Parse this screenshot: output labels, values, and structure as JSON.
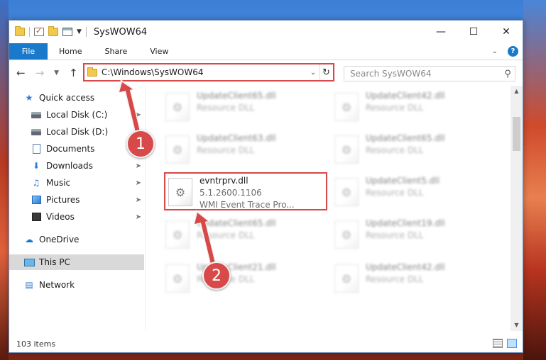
{
  "window": {
    "title": "SysWOW64",
    "controls": {
      "minimize": "—",
      "maximize": "☐",
      "close": "✕"
    }
  },
  "ribbon": {
    "file_tab": "File",
    "tabs": [
      "Home",
      "Share",
      "View"
    ],
    "help": "?"
  },
  "address_bar": {
    "path": "C:\\Windows\\SysWOW64",
    "search_placeholder": "Search SysWOW64"
  },
  "sidebar": {
    "items": [
      {
        "label": "Quick access",
        "icon": "star-icon",
        "pinned": false
      },
      {
        "label": "Local Disk (C:)",
        "icon": "disk-icon",
        "pinned": true
      },
      {
        "label": "Local Disk (D:)",
        "icon": "disk-icon",
        "pinned": false
      },
      {
        "label": "Documents",
        "icon": "document-icon",
        "pinned": true
      },
      {
        "label": "Downloads",
        "icon": "download-icon",
        "pinned": true
      },
      {
        "label": "Music",
        "icon": "music-icon",
        "pinned": true
      },
      {
        "label": "Pictures",
        "icon": "pictures-icon",
        "pinned": true
      },
      {
        "label": "Videos",
        "icon": "videos-icon",
        "pinned": true
      },
      {
        "label": "OneDrive",
        "icon": "onedrive-icon",
        "pinned": false
      },
      {
        "label": "This PC",
        "icon": "this-pc-icon",
        "pinned": false,
        "selected": true
      },
      {
        "label": "Network",
        "icon": "network-icon",
        "pinned": false
      }
    ]
  },
  "files": {
    "highlighted": {
      "name": "evntrprv.dll",
      "version": "5.1.2600.1106",
      "description": "WMI Event Trace Pro..."
    },
    "blurred": [
      {
        "name": "UpdateClient65.dll",
        "type": "Resource DLL"
      },
      {
        "name": "UpdateClient42.dll",
        "type": "Resource DLL"
      },
      {
        "name": "UpdateClient63.dll",
        "type": "Resource DLL"
      },
      {
        "name": "UpdateClient65.dll",
        "type": "Resource DLL"
      },
      {
        "name": "UpdateClient5.dll",
        "type": "Resource DLL"
      },
      {
        "name": "UpdateClient65.dll",
        "type": "Resource DLL"
      },
      {
        "name": "UpdateClient19.dll",
        "type": "Resource DLL"
      },
      {
        "name": "UpdateClient21.dll",
        "type": "Resource DLL"
      },
      {
        "name": "UpdateClient42.dll",
        "type": "Resource DLL"
      }
    ]
  },
  "status": {
    "item_count": "103 items"
  },
  "annotations": {
    "step1": "1",
    "step2": "2",
    "color": "#d84848"
  }
}
